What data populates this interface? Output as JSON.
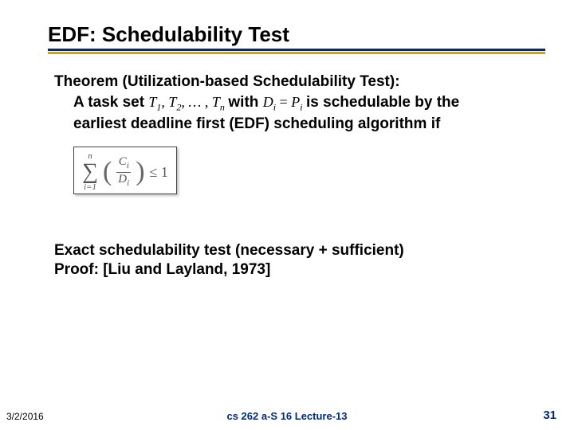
{
  "title": "EDF: Schedulability Test",
  "theorem_head": "Theorem (Utilization-based Schedulability Test):",
  "task_pre": "A task set ",
  "task_set_math_1": "T",
  "task_set_sub_1": "1",
  "task_set_math_2": "T",
  "task_set_sub_2": "2",
  "task_set_ellipsis": "…",
  "task_set_math_n": "T",
  "task_set_sub_n": "n",
  "task_with": " with ",
  "cond_D": "D",
  "cond_i1": "i",
  "cond_eq": " = ",
  "cond_P": "P",
  "cond_i2": "i",
  "task_post": " is schedulable by the earliest deadline first (EDF) scheduling algorithm if",
  "formula": {
    "upper": "n",
    "lower": "i=1",
    "num": "Cᵢ",
    "num_letter": "C",
    "num_sub": "i",
    "den_letter": "D",
    "den_sub": "i",
    "rhs": "≤ 1"
  },
  "exact": "Exact schedulability test (necessary + sufficient)",
  "proof": "Proof: [Liu and Layland, 1973]",
  "footer": {
    "date": "3/2/2016",
    "center": "cs 262 a-S 16 Lecture-13",
    "page": "31"
  },
  "chart_data": {
    "type": "table",
    "title": "EDF utilization-based schedulability test",
    "condition": "D_i = P_i for all i",
    "test": "sum_{i=1}^{n} (C_i / D_i) <= 1",
    "nature": "necessary and sufficient",
    "reference": "Liu and Layland, 1973"
  }
}
